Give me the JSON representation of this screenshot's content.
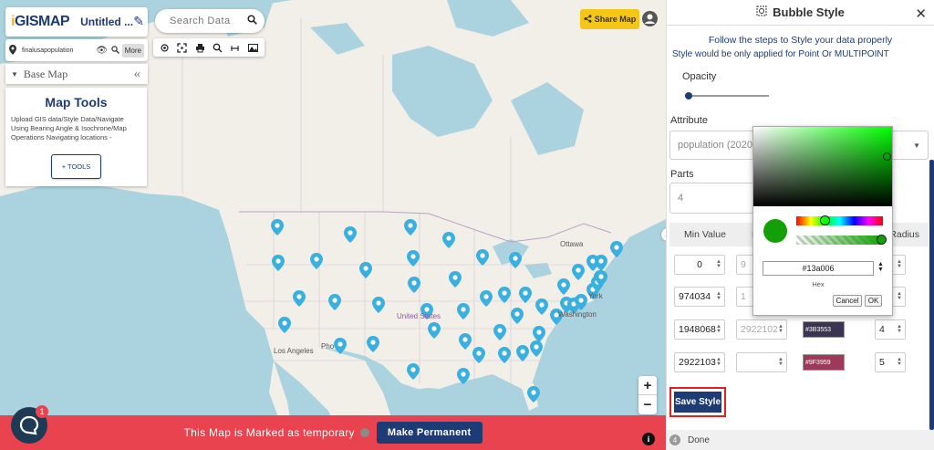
{
  "header": {
    "logo": "GISMAP",
    "logo_initial": "i",
    "map_title": "Untitled ..."
  },
  "layer": {
    "name": "finalusapopulation",
    "more_label": "More"
  },
  "basemap": {
    "label": "Base Map"
  },
  "tools": {
    "title": "Map Tools",
    "description": "Upload GIS data/Style Data/Navigate Using Bearing Angle & Isochrone/Map Operations Navigating locations -",
    "button": "+ TOOLS"
  },
  "search": {
    "placeholder": "Search Data"
  },
  "share": {
    "label": "Share Map"
  },
  "map_labels": {
    "ottawa": "Ottawa",
    "united_states": "United States",
    "los_angeles": "Los Angeles",
    "phoenix": "Pho",
    "washington": "Washington",
    "york": "York"
  },
  "zoom": {
    "in": "+",
    "out": "−"
  },
  "banner": {
    "text": "This Map is Marked as temporary",
    "button": "Make Permanent"
  },
  "chat": {
    "badge": "1"
  },
  "panel": {
    "title": "Bubble Style",
    "steps_text": "Follow the steps to Style your data properly",
    "steps_sub": "Style would be only applied for Point Or MULTIPOINT",
    "opacity_label": "Opacity",
    "opacity_value": 0.03,
    "attribute_label": "Attribute",
    "attribute_value": "population (2020)",
    "parts_label": "Parts",
    "parts_value": "4",
    "columns": {
      "min": "Min Value",
      "max": "M",
      "radius": "Radius"
    },
    "rows": [
      {
        "min": "0",
        "max": "9",
        "color": "",
        "radius": "2"
      },
      {
        "min": "974034",
        "max": "1",
        "color": "",
        "radius": "3"
      },
      {
        "min": "1948068",
        "max": "2922102",
        "color": "#3B3553",
        "radius": "4"
      },
      {
        "min": "2922103",
        "max": "",
        "color": "#9F3959",
        "radius": "5"
      }
    ],
    "save_label": "Save Style",
    "step_number": "4",
    "step_label": "Done"
  },
  "picker": {
    "hex": "#13a006",
    "hex_label": "Hex",
    "cancel": "Cancel",
    "ok": "OK"
  },
  "colors": {
    "brand": "#1d3b74",
    "banner": "#e8434f",
    "share": "#f5c518",
    "pin": "#3ab0e0",
    "selected": "#13a006"
  }
}
